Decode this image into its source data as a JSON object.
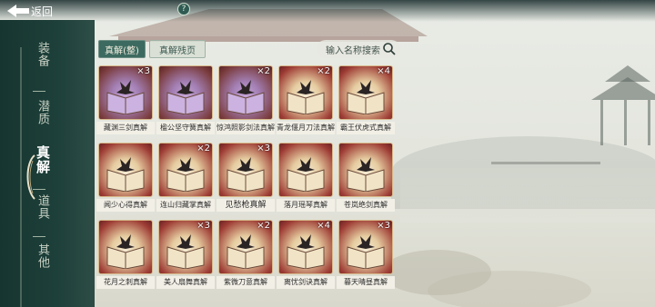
{
  "topbar": {
    "back_label": "返回",
    "help_glyph": "?"
  },
  "sidenav": {
    "items": [
      {
        "label": "装备",
        "active": false
      },
      {
        "label": "潜质",
        "active": false
      },
      {
        "label": "真解",
        "active": true
      },
      {
        "label": "道具",
        "active": false
      },
      {
        "label": "其他",
        "active": false
      }
    ]
  },
  "tabs": {
    "active_label": "真解(整)",
    "inactive_label": "真解残页"
  },
  "search": {
    "placeholder": "输入名称搜索",
    "icon": "search-icon"
  },
  "cards": [
    {
      "name": "藏渊三剑真解",
      "count": "×3",
      "rarity": "purple"
    },
    {
      "name": "楹公坚守簧真解",
      "count": "",
      "rarity": "purple"
    },
    {
      "name": "惊鸿照影剑法真解",
      "count": "×2",
      "rarity": "purple"
    },
    {
      "name": "青龙偃月刀法真解",
      "count": "×2",
      "rarity": "gold"
    },
    {
      "name": "霸王伏虎式真解",
      "count": "×4",
      "rarity": "gold"
    },
    {
      "name": "闻少心得真解",
      "count": "",
      "rarity": "gold"
    },
    {
      "name": "连山归藏掌真解",
      "count": "×2",
      "rarity": "gold"
    },
    {
      "name": "见愁枪真解",
      "count": "×3",
      "rarity": "gold"
    },
    {
      "name": "落月瑶琴真解",
      "count": "",
      "rarity": "gold"
    },
    {
      "name": "苍岚绝剑真解",
      "count": "",
      "rarity": "gold"
    },
    {
      "name": "花月之刺真解",
      "count": "",
      "rarity": "gold"
    },
    {
      "name": "美人扇舞真解",
      "count": "×3",
      "rarity": "gold"
    },
    {
      "name": "紫微刀意真解",
      "count": "×2",
      "rarity": "gold"
    },
    {
      "name": "离忧剑诀真解",
      "count": "×4",
      "rarity": "gold"
    },
    {
      "name": "暮天晴昼真解",
      "count": "×3",
      "rarity": "gold"
    }
  ],
  "colors": {
    "nav_bg": "#1e403a",
    "tab_active": "#3d6a60",
    "card_gold_border": "#d8b98a"
  }
}
